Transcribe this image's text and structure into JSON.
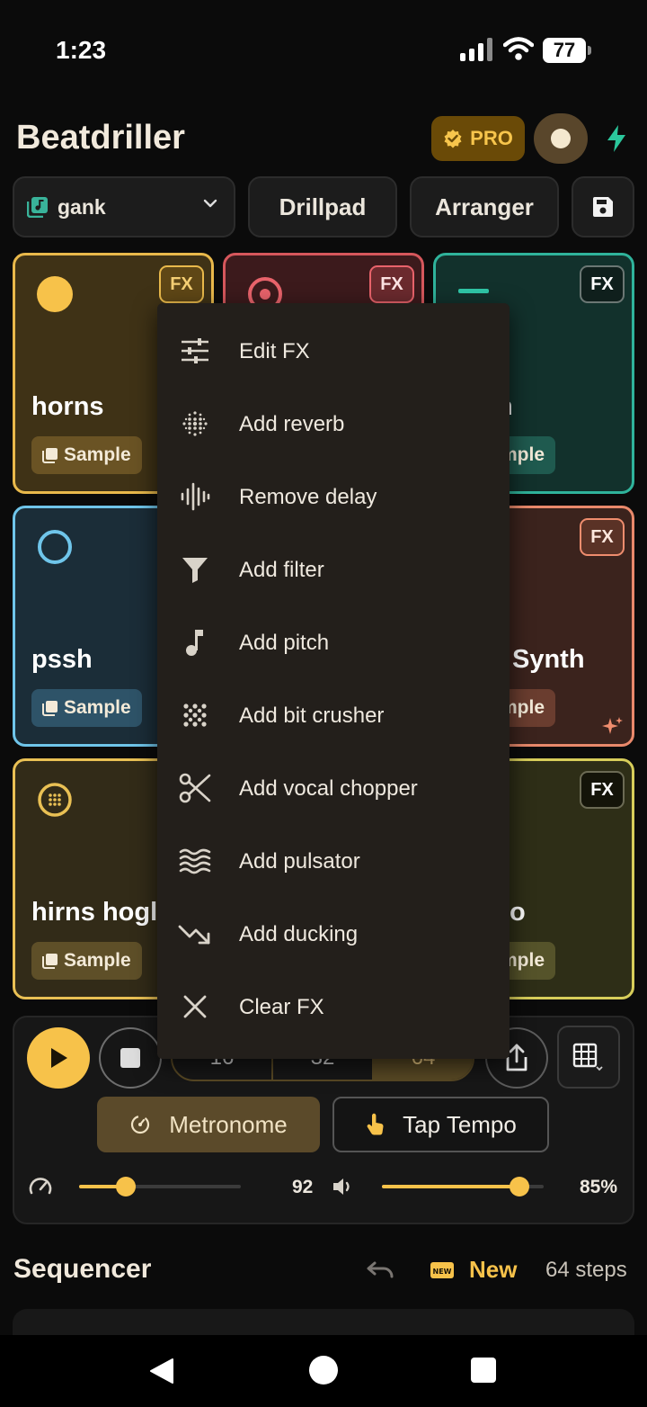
{
  "status_bar": {
    "time": "1:23",
    "battery": "77"
  },
  "header": {
    "title": "Beatdriller",
    "pro_label": "PRO"
  },
  "toolbar": {
    "project_name": "gank",
    "drillpad_label": "Drillpad",
    "arranger_label": "Arranger"
  },
  "pads": [
    {
      "name": "horns",
      "tag": "Sample",
      "fx": "FX"
    },
    {
      "name": "",
      "tag": "",
      "fx": "FX"
    },
    {
      "name": "n",
      "tag": "mple",
      "fx": "FX"
    },
    {
      "name": "pssh",
      "tag": "Sample",
      "fx": ""
    },
    {
      "name": "Synth",
      "tag": "mple",
      "fx": "FX"
    },
    {
      "name": "hirns hogl",
      "tag": "Sample",
      "fx": ""
    },
    {
      "name": "o",
      "tag": "mple",
      "fx": "FX"
    }
  ],
  "fx_menu": {
    "items": [
      {
        "label": "Edit FX",
        "icon": "sliders-icon"
      },
      {
        "label": "Add reverb",
        "icon": "reverb-dots-icon"
      },
      {
        "label": "Remove delay",
        "icon": "waveform-icon"
      },
      {
        "label": "Add filter",
        "icon": "filter-funnel-icon"
      },
      {
        "label": "Add pitch",
        "icon": "music-note-icon"
      },
      {
        "label": "Add bit crusher",
        "icon": "bit-crusher-dots-icon"
      },
      {
        "label": "Add vocal chopper",
        "icon": "scissors-icon"
      },
      {
        "label": "Add pulsator",
        "icon": "waves-icon"
      },
      {
        "label": "Add ducking",
        "icon": "trending-down-icon"
      },
      {
        "label": "Clear FX",
        "icon": "close-icon"
      }
    ]
  },
  "transport": {
    "step_options": [
      "16",
      "32",
      "64"
    ],
    "selected_steps": "64",
    "metronome_label": "Metronome",
    "tap_tempo_label": "Tap Tempo",
    "tempo_value": "92",
    "tempo_fraction": 0.29,
    "volume_value": "85%",
    "volume_fraction": 0.85
  },
  "sequencer": {
    "title": "Sequencer",
    "new_label": "New",
    "steps_label": "64 steps"
  },
  "colors": {
    "accent": "#f7c24a",
    "background": "#0b0b0b",
    "menu_background": "#231f1b"
  }
}
